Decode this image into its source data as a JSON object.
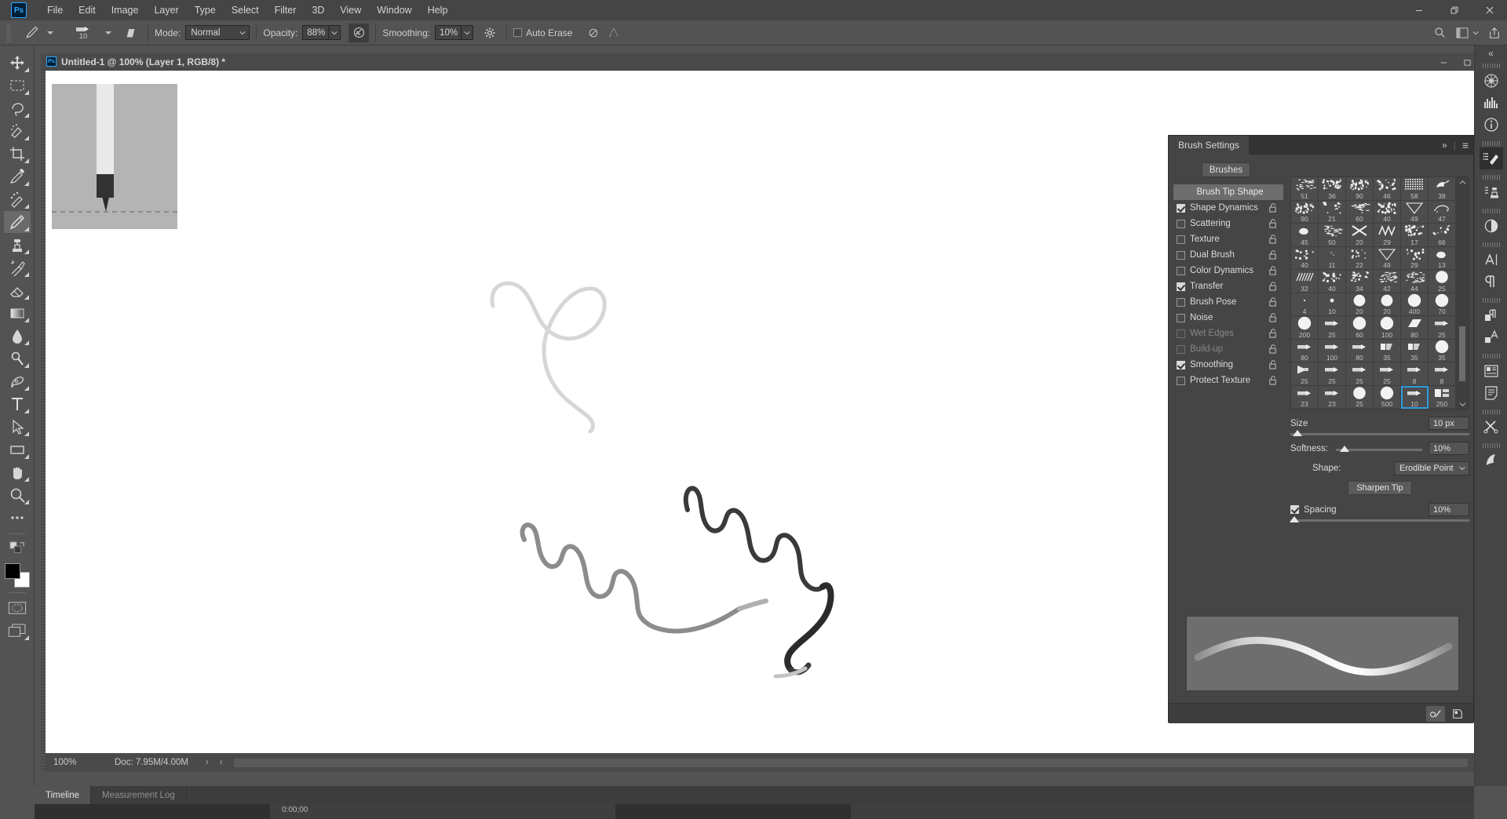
{
  "app": {
    "name": "Ps",
    "logo_label": "Ps"
  },
  "menubar": {
    "items": [
      {
        "label": "File"
      },
      {
        "label": "Edit"
      },
      {
        "label": "Image"
      },
      {
        "label": "Layer"
      },
      {
        "label": "Type"
      },
      {
        "label": "Select"
      },
      {
        "label": "Filter"
      },
      {
        "label": "3D"
      },
      {
        "label": "View"
      },
      {
        "label": "Window"
      },
      {
        "label": "Help"
      }
    ],
    "window_controls": [
      {
        "name": "minimize",
        "glyph": "—"
      },
      {
        "name": "restore",
        "glyph": "❐"
      },
      {
        "name": "close",
        "glyph": "✕"
      }
    ]
  },
  "options_bar": {
    "tool_icon": "pencil-icon",
    "brush_size_label": "10",
    "mode_label": "Mode:",
    "mode_value": "Normal",
    "opacity_label": "Opacity:",
    "opacity_value": "88%",
    "smoothing_label": "Smoothing:",
    "smoothing_value": "10%",
    "auto_erase_label": "Auto Erase",
    "auto_erase_checked": false,
    "right_icons": [
      "search-icon",
      "workspace-icon",
      "chevron-down-icon",
      "share-icon"
    ]
  },
  "toolbar": {
    "tools": [
      {
        "name": "move-tool",
        "icon": "move-icon",
        "active": false
      },
      {
        "name": "marquee-tool",
        "icon": "rectangular-marquee-icon",
        "active": false
      },
      {
        "name": "lasso-tool",
        "icon": "lasso-icon",
        "active": false
      },
      {
        "name": "quick-selection-tool",
        "icon": "quick-selection-icon",
        "active": false
      },
      {
        "name": "crop-tool",
        "icon": "crop-icon",
        "active": false
      },
      {
        "name": "eyedropper-tool",
        "icon": "eyedropper-icon",
        "active": false
      },
      {
        "name": "spot-healing-tool",
        "icon": "spot-healing-brush-icon",
        "active": false
      },
      {
        "name": "pencil-tool",
        "icon": "pencil-icon",
        "active": true
      },
      {
        "name": "clone-stamp-tool",
        "icon": "clone-stamp-icon",
        "active": false
      },
      {
        "name": "history-brush-tool",
        "icon": "history-brush-icon",
        "active": false
      },
      {
        "name": "eraser-tool",
        "icon": "eraser-icon",
        "active": false
      },
      {
        "name": "gradient-tool",
        "icon": "gradient-icon",
        "active": false
      },
      {
        "name": "blur-tool",
        "icon": "blur-drop-icon",
        "active": false
      },
      {
        "name": "dodge-tool",
        "icon": "dodge-icon",
        "active": false
      },
      {
        "name": "pen-tool",
        "icon": "pen-icon",
        "active": false
      },
      {
        "name": "type-tool",
        "icon": "type-t-icon",
        "active": false
      },
      {
        "name": "path-selection-tool",
        "icon": "path-selection-arrow-icon",
        "active": false
      },
      {
        "name": "rectangle-tool",
        "icon": "rectangle-shape-icon",
        "active": false
      },
      {
        "name": "hand-tool",
        "icon": "hand-icon",
        "active": false
      },
      {
        "name": "zoom-tool",
        "icon": "magnifier-icon",
        "active": false
      },
      {
        "name": "edit-toolbar",
        "icon": "ellipsis-icon",
        "active": false
      }
    ],
    "foreground_color": "#000000",
    "background_color": "#ffffff",
    "quick_mask_icon": "quick-mask-icon",
    "screen_mode_icon": "screen-mode-icon"
  },
  "document": {
    "title": "Untitled-1 @ 100% (Layer 1, RGB/8) *",
    "window_controls": [
      {
        "name": "minimize",
        "glyph": "—"
      },
      {
        "name": "maximize",
        "glyph": "▭"
      },
      {
        "name": "close",
        "glyph": "✕"
      }
    ],
    "brush_tip_preview_name": "erodible-tip-preview"
  },
  "status_bar": {
    "zoom": "100%",
    "doc_info": "Doc: 7.95M/4.00M",
    "expand_glyph": "›",
    "collapse_glyph": "‹"
  },
  "brush_settings": {
    "panel_title": "Brush Settings",
    "collapse_glyph": "»",
    "menu_glyph": "≡",
    "brushes_button": "Brushes",
    "options": [
      {
        "label": "Brush Tip Shape",
        "type": "header",
        "checked": false,
        "disabled": false
      },
      {
        "label": "Shape Dynamics",
        "type": "check",
        "checked": true,
        "disabled": false
      },
      {
        "label": "Scattering",
        "type": "check",
        "checked": false,
        "disabled": false
      },
      {
        "label": "Texture",
        "type": "check",
        "checked": false,
        "disabled": false
      },
      {
        "label": "Dual Brush",
        "type": "check",
        "checked": false,
        "disabled": false
      },
      {
        "label": "Color Dynamics",
        "type": "check",
        "checked": false,
        "disabled": false
      },
      {
        "label": "Transfer",
        "type": "check",
        "checked": true,
        "disabled": false
      },
      {
        "label": "Brush Pose",
        "type": "check",
        "checked": false,
        "disabled": false
      },
      {
        "label": "Noise",
        "type": "check",
        "checked": false,
        "disabled": false
      },
      {
        "label": "Wet Edges",
        "type": "check",
        "checked": false,
        "disabled": true
      },
      {
        "label": "Build-up",
        "type": "check",
        "checked": false,
        "disabled": true
      },
      {
        "label": "Smoothing",
        "type": "check",
        "checked": true,
        "disabled": false
      },
      {
        "label": "Protect Texture",
        "type": "check",
        "checked": false,
        "disabled": false
      }
    ],
    "brush_grid": [
      {
        "size": "51",
        "shape": "texture"
      },
      {
        "size": "36",
        "shape": "flick"
      },
      {
        "size": "90",
        "shape": "spatter"
      },
      {
        "size": "46",
        "shape": "dots"
      },
      {
        "size": "58",
        "shape": "weave"
      },
      {
        "size": "38",
        "shape": "bird"
      },
      {
        "size": "90",
        "shape": "spatter"
      },
      {
        "size": "21",
        "shape": "sparse"
      },
      {
        "size": "60",
        "shape": "streak"
      },
      {
        "size": "40",
        "shape": "spatter"
      },
      {
        "size": "49",
        "shape": "triangle"
      },
      {
        "size": "47",
        "shape": "swirl"
      },
      {
        "size": "45",
        "shape": "blob"
      },
      {
        "size": "50",
        "shape": "streak"
      },
      {
        "size": "20",
        "shape": "cross"
      },
      {
        "size": "29",
        "shape": "zigzag"
      },
      {
        "size": "17",
        "shape": "flick"
      },
      {
        "size": "66",
        "shape": "sparse"
      },
      {
        "size": "40",
        "shape": "sparse"
      },
      {
        "size": "11",
        "shape": "tiny"
      },
      {
        "size": "22",
        "shape": "sparse"
      },
      {
        "size": "49",
        "shape": "triangle"
      },
      {
        "size": "29",
        "shape": "sparse"
      },
      {
        "size": "13",
        "shape": "blob"
      },
      {
        "size": "32",
        "shape": "hatch"
      },
      {
        "size": "40",
        "shape": "dots"
      },
      {
        "size": "34",
        "shape": "dots"
      },
      {
        "size": "42",
        "shape": "streak"
      },
      {
        "size": "44",
        "shape": "streak"
      },
      {
        "size": "25",
        "shape": "circle"
      },
      {
        "size": "4",
        "shape": "dot-tiny"
      },
      {
        "size": "10",
        "shape": "dot-small"
      },
      {
        "size": "20",
        "shape": "circle"
      },
      {
        "size": "20",
        "shape": "circle"
      },
      {
        "size": "400",
        "shape": "circle"
      },
      {
        "size": "70",
        "shape": "circle"
      },
      {
        "size": "200",
        "shape": "circle"
      },
      {
        "size": "25",
        "shape": "erodible"
      },
      {
        "size": "60",
        "shape": "circle"
      },
      {
        "size": "100",
        "shape": "circle"
      },
      {
        "size": "80",
        "shape": "flat"
      },
      {
        "size": "25",
        "shape": "erodible"
      },
      {
        "size": "80",
        "shape": "erodible"
      },
      {
        "size": "100",
        "shape": "erodible"
      },
      {
        "size": "80",
        "shape": "erodible"
      },
      {
        "size": "35",
        "shape": "chisel"
      },
      {
        "size": "35",
        "shape": "chisel"
      },
      {
        "size": "35",
        "shape": "circle"
      },
      {
        "size": "25",
        "shape": "airbrush"
      },
      {
        "size": "25",
        "shape": "erodible"
      },
      {
        "size": "25",
        "shape": "erodible"
      },
      {
        "size": "25",
        "shape": "erodible"
      },
      {
        "size": "8",
        "shape": "erodible"
      },
      {
        "size": "8",
        "shape": "erodible"
      },
      {
        "size": "23",
        "shape": "erodible"
      },
      {
        "size": "23",
        "shape": "erodible"
      },
      {
        "size": "25",
        "shape": "circle"
      },
      {
        "size": "500",
        "shape": "circle"
      },
      {
        "size": "10",
        "shape": "erodible",
        "selected": true
      },
      {
        "size": "250",
        "shape": "square-split"
      }
    ],
    "size_label": "Size",
    "size_value": "10 px",
    "size_percent": 4,
    "softness_label": "Softness:",
    "softness_value": "10%",
    "softness_percent": 10,
    "shape_label": "Shape:",
    "shape_value": "Erodible Point",
    "sharpen_tip_button": "Sharpen Tip",
    "spacing_label": "Spacing",
    "spacing_checked": true,
    "spacing_value": "10%",
    "spacing_percent": 2,
    "footer_buttons": [
      {
        "name": "toggle-brush-settings-icon",
        "active": true
      },
      {
        "name": "new-brush-icon",
        "active": false
      }
    ]
  },
  "right_dock": {
    "collapse_glyph": "«",
    "groups": [
      {
        "icons": [
          {
            "name": "3d-icon"
          },
          {
            "name": "histogram-icon"
          },
          {
            "name": "info-icon"
          }
        ]
      },
      {
        "icons": [
          {
            "name": "brush-settings-icon",
            "active": true
          }
        ]
      },
      {
        "icons": [
          {
            "name": "clone-source-icon"
          }
        ]
      },
      {
        "icons": [
          {
            "name": "adjustments-icon"
          }
        ]
      },
      {
        "icons": [
          {
            "name": "character-icon"
          },
          {
            "name": "paragraph-icon"
          }
        ]
      },
      {
        "icons": [
          {
            "name": "paragraph-styles-icon"
          },
          {
            "name": "character-styles-icon"
          }
        ]
      },
      {
        "icons": [
          {
            "name": "libraries-icon"
          },
          {
            "name": "notes-icon"
          }
        ]
      },
      {
        "icons": [
          {
            "name": "actions-icon"
          }
        ]
      },
      {
        "icons": [
          {
            "name": "history-icon"
          }
        ]
      }
    ]
  },
  "timeline": {
    "tabs": [
      {
        "label": "Timeline",
        "active": true
      },
      {
        "label": "Measurement Log",
        "active": false
      }
    ],
    "time_value": "0:00;00"
  }
}
